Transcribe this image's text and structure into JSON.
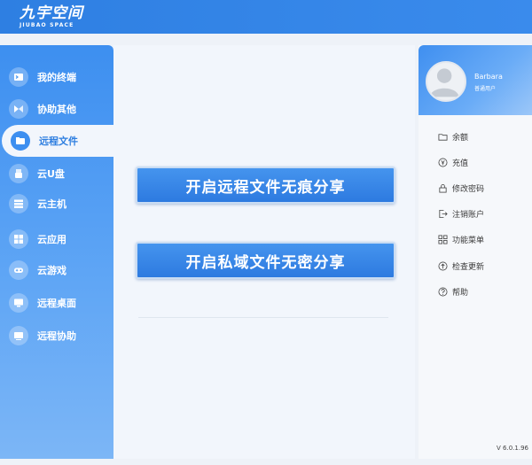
{
  "app": {
    "logo_main": "九宇空间",
    "logo_sub": "JIUBAO SPACE"
  },
  "sidebar": {
    "items": [
      {
        "label": "我的终端",
        "icon": "terminal-icon",
        "active": false
      },
      {
        "label": "协助其他",
        "icon": "assist-icon",
        "active": false
      },
      {
        "label": "远程文件",
        "icon": "folder-icon",
        "active": true
      },
      {
        "label": "云U盘",
        "icon": "usb-drive-icon",
        "active": false
      },
      {
        "label": "云主机",
        "icon": "server-icon",
        "active": false
      },
      {
        "label": "云应用",
        "icon": "apps-icon",
        "active": false
      },
      {
        "label": "云游戏",
        "icon": "gamepad-icon",
        "active": false
      },
      {
        "label": "远程桌面",
        "icon": "desktop-icon",
        "active": false
      },
      {
        "label": "远程协助",
        "icon": "remote-assist-icon",
        "active": false
      }
    ]
  },
  "main": {
    "button_remote_share": "开启远程文件无痕分享",
    "button_private_share": "开启私域文件无密分享"
  },
  "profile": {
    "username": "Barbara",
    "user_type": "普通用户"
  },
  "menu": {
    "items": [
      {
        "label": "余额",
        "icon": "wallet-icon"
      },
      {
        "label": "充值",
        "icon": "yen-coin-icon"
      },
      {
        "label": "修改密码",
        "icon": "lock-icon"
      },
      {
        "label": "注销账户",
        "icon": "logout-icon"
      },
      {
        "label": "功能菜单",
        "icon": "grid-menu-icon"
      },
      {
        "label": "检查更新",
        "icon": "update-icon"
      },
      {
        "label": "帮助",
        "icon": "help-icon"
      }
    ]
  },
  "version": "V 6.0.1.96",
  "colors": {
    "primary": "#2e7fe2",
    "sidebar_top": "#3d8ff0",
    "panel_bg": "#f2f6fc"
  }
}
